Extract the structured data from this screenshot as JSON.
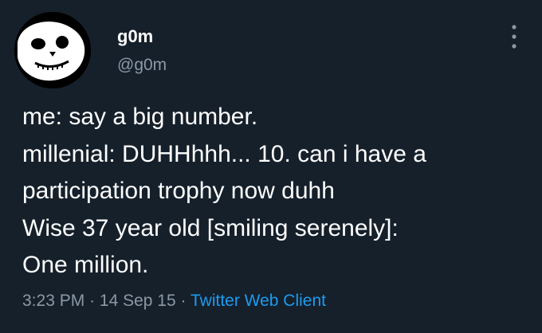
{
  "author": {
    "display_name": "g0m",
    "handle": "@g0m",
    "avatar_icon": "skull-face-avatar"
  },
  "more_options_icon": "vertical-dots-icon",
  "tweet": {
    "lines": [
      "me: say a big number.",
      "millenial: DUHHhhh... 10. can i have a",
      "participation trophy now duhh",
      "Wise 37 year old [smiling serenely]:",
      "One million."
    ]
  },
  "meta": {
    "time": "3:23 PM",
    "separator": "·",
    "date": "14 Sep 15",
    "client": "Twitter Web Client"
  },
  "colors": {
    "background": "#15202b",
    "text": "#ffffff",
    "secondary_text": "#8b98a5",
    "link": "#1d9bf0"
  }
}
